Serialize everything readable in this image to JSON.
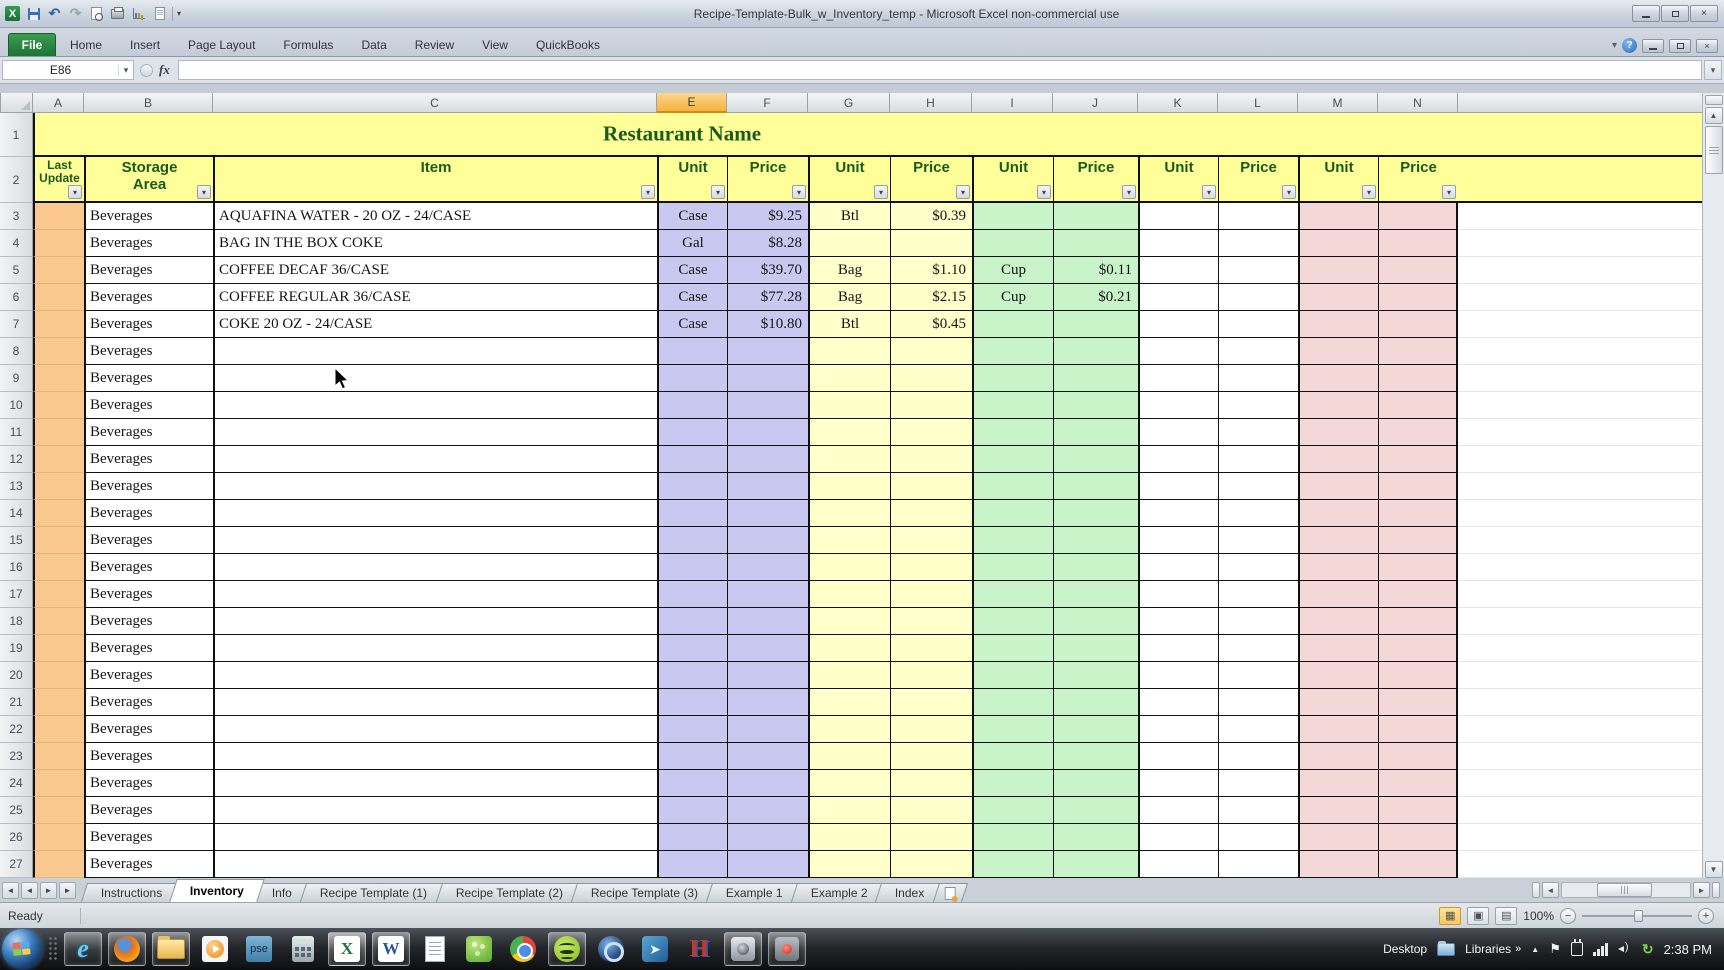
{
  "window": {
    "title": "Recipe-Template-Bulk_w_Inventory_temp  -  Microsoft Excel non-commercial use"
  },
  "quick_access": {
    "icon_names": [
      "excel-logo-icon",
      "save-icon",
      "undo-icon",
      "redo-icon",
      "print-preview-icon",
      "print-icon",
      "chart-edit-icon",
      "new-document-icon",
      "customize-quick-access-icon"
    ]
  },
  "ribbon": {
    "file_label": "File",
    "tabs": [
      "Home",
      "Insert",
      "Page Layout",
      "Formulas",
      "Data",
      "Review",
      "View",
      "QuickBooks"
    ]
  },
  "formula_bar": {
    "name_box": "E86",
    "fx_label": "fx",
    "formula_value": ""
  },
  "sheet": {
    "column_letters": [
      "A",
      "B",
      "C",
      "E",
      "F",
      "G",
      "H",
      "I",
      "J",
      "K",
      "L",
      "M",
      "N"
    ],
    "selected_column_letter": "E",
    "row_numbers": [
      1,
      2,
      3,
      4,
      5,
      6,
      7,
      8,
      9,
      10,
      11,
      12,
      13,
      14,
      15,
      16,
      17,
      18,
      19,
      20,
      21,
      22,
      23,
      24,
      25,
      26,
      27
    ],
    "title_row": {
      "text": "Restaurant Name"
    },
    "header_row": {
      "col_a": "Last Update",
      "col_b": "Storage Area",
      "col_c": "Item",
      "unit_label": "Unit",
      "price_label": "Price"
    },
    "rows": [
      {
        "cells": [
          "Beverages",
          "AQUAFINA WATER - 20 OZ - 24/CASE",
          "Case",
          "$9.25",
          "Btl",
          "$0.39",
          "",
          "",
          "",
          "",
          "",
          ""
        ]
      },
      {
        "cells": [
          "Beverages",
          "BAG IN THE BOX COKE",
          "Gal",
          "$8.28",
          "",
          "",
          "",
          "",
          "",
          "",
          "",
          ""
        ]
      },
      {
        "cells": [
          "Beverages",
          "COFFEE DECAF 36/CASE",
          "Case",
          "$39.70",
          "Bag",
          "$1.10",
          "Cup",
          "$0.11",
          "",
          "",
          "",
          ""
        ]
      },
      {
        "cells": [
          "Beverages",
          "COFFEE REGULAR 36/CASE",
          "Case",
          "$77.28",
          "Bag",
          "$2.15",
          "Cup",
          "$0.21",
          "",
          "",
          "",
          ""
        ]
      },
      {
        "cells": [
          "Beverages",
          "COKE 20 OZ - 24/CASE",
          "Case",
          "$10.80",
          "Btl",
          "$0.45",
          "",
          "",
          "",
          "",
          "",
          ""
        ]
      },
      {
        "cells": [
          "Beverages",
          "",
          "",
          "",
          "",
          "",
          "",
          "",
          "",
          "",
          "",
          ""
        ]
      },
      {
        "cells": [
          "Beverages",
          "",
          "",
          "",
          "",
          "",
          "",
          "",
          "",
          "",
          "",
          ""
        ]
      },
      {
        "cells": [
          "Beverages",
          "",
          "",
          "",
          "",
          "",
          "",
          "",
          "",
          "",
          "",
          ""
        ]
      },
      {
        "cells": [
          "Beverages",
          "",
          "",
          "",
          "",
          "",
          "",
          "",
          "",
          "",
          "",
          ""
        ]
      },
      {
        "cells": [
          "Beverages",
          "",
          "",
          "",
          "",
          "",
          "",
          "",
          "",
          "",
          "",
          ""
        ]
      },
      {
        "cells": [
          "Beverages",
          "",
          "",
          "",
          "",
          "",
          "",
          "",
          "",
          "",
          "",
          ""
        ]
      },
      {
        "cells": [
          "Beverages",
          "",
          "",
          "",
          "",
          "",
          "",
          "",
          "",
          "",
          "",
          ""
        ]
      },
      {
        "cells": [
          "Beverages",
          "",
          "",
          "",
          "",
          "",
          "",
          "",
          "",
          "",
          "",
          ""
        ]
      },
      {
        "cells": [
          "Beverages",
          "",
          "",
          "",
          "",
          "",
          "",
          "",
          "",
          "",
          "",
          ""
        ]
      },
      {
        "cells": [
          "Beverages",
          "",
          "",
          "",
          "",
          "",
          "",
          "",
          "",
          "",
          "",
          ""
        ]
      },
      {
        "cells": [
          "Beverages",
          "",
          "",
          "",
          "",
          "",
          "",
          "",
          "",
          "",
          "",
          ""
        ]
      },
      {
        "cells": [
          "Beverages",
          "",
          "",
          "",
          "",
          "",
          "",
          "",
          "",
          "",
          "",
          ""
        ]
      },
      {
        "cells": [
          "Beverages",
          "",
          "",
          "",
          "",
          "",
          "",
          "",
          "",
          "",
          "",
          ""
        ]
      },
      {
        "cells": [
          "Beverages",
          "",
          "",
          "",
          "",
          "",
          "",
          "",
          "",
          "",
          "",
          ""
        ]
      },
      {
        "cells": [
          "Beverages",
          "",
          "",
          "",
          "",
          "",
          "",
          "",
          "",
          "",
          "",
          ""
        ]
      },
      {
        "cells": [
          "Beverages",
          "",
          "",
          "",
          "",
          "",
          "",
          "",
          "",
          "",
          "",
          ""
        ]
      },
      {
        "cells": [
          "Beverages",
          "",
          "",
          "",
          "",
          "",
          "",
          "",
          "",
          "",
          "",
          ""
        ]
      },
      {
        "cells": [
          "Beverages",
          "",
          "",
          "",
          "",
          "",
          "",
          "",
          "",
          "",
          "",
          ""
        ]
      },
      {
        "cells": [
          "Beverages",
          "",
          "",
          "",
          "",
          "",
          "",
          "",
          "",
          "",
          "",
          ""
        ]
      },
      {
        "cells": [
          "Beverages",
          "",
          "",
          "",
          "",
          "",
          "",
          "",
          "",
          "",
          "",
          ""
        ]
      }
    ]
  },
  "sheet_tabs": {
    "tabs": [
      "Instructions",
      "Inventory",
      "Info",
      "Recipe Template (1)",
      "Recipe Template (2)",
      "Recipe Template (3)",
      "Example 1",
      "Example 2",
      "Index"
    ],
    "active_tab": "Inventory"
  },
  "status_bar": {
    "mode": "Ready",
    "zoom_level": "100%"
  },
  "taskbar": {
    "icons": [
      {
        "name": "internet-explorer-icon",
        "label": "e",
        "framed": true
      },
      {
        "name": "firefox-icon",
        "framed": true
      },
      {
        "name": "windows-explorer-icon",
        "framed": true
      },
      {
        "name": "media-player-icon",
        "framed": false
      },
      {
        "name": "photoshop-elements-icon",
        "label": "pse",
        "framed": false
      },
      {
        "name": "calculator-icon",
        "framed": false
      },
      {
        "name": "excel-icon",
        "label": "X",
        "framed": true,
        "active": true
      },
      {
        "name": "word-icon",
        "label": "W",
        "framed": true
      },
      {
        "name": "notepad-icon",
        "framed": false
      },
      {
        "name": "green-app-icon",
        "framed": false
      },
      {
        "name": "chrome-icon",
        "framed": false
      },
      {
        "name": "spotify-icon",
        "framed": true
      },
      {
        "name": "quicktime-icon",
        "framed": false
      },
      {
        "name": "jing-icon",
        "framed": false
      },
      {
        "name": "h-app-icon",
        "label": "H",
        "framed": false
      },
      {
        "name": "webcam-icon",
        "framed": true
      },
      {
        "name": "recorder-icon",
        "framed": true
      }
    ],
    "tray": {
      "desktop_label": "Desktop",
      "libraries_label": "Libraries",
      "overflow_chevron": "»",
      "time": "2:38 PM"
    }
  },
  "icons": {
    "dropdown-arrow": "▾",
    "up-arrow": "▲",
    "down-arrow": "▼",
    "left-arrow": "◄",
    "right-arrow": "►",
    "tab-first": "◄",
    "tab-last": "►",
    "undo": "↶",
    "redo": "↷",
    "help": "?",
    "close": "×",
    "minimize": "–",
    "flag": "⚑",
    "sync": "↻",
    "minus": "−",
    "plus": "+",
    "view-normal": "▦",
    "view-page-layout": "▣",
    "view-page-break": "▤"
  }
}
